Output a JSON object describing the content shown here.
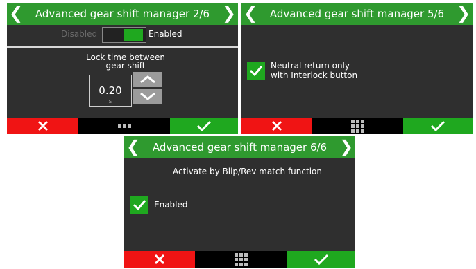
{
  "screens": [
    {
      "title": "Advanced gear shift manager 2/6",
      "toggle": {
        "off_label": "Disabled",
        "on_label": "Enabled",
        "state": "on"
      },
      "lock_time": {
        "label": "Lock time between gear shift",
        "value": "0.20",
        "unit": "s"
      }
    },
    {
      "title": "Advanced gear shift manager 5/6",
      "checkbox": {
        "label_line1": "Neutral return only",
        "label_line2": "with Interlock button",
        "checked": true
      }
    },
    {
      "title": "Advanced gear shift manager 6/6",
      "heading": "Activate by Blip/Rev match function",
      "checkbox": {
        "label": "Enabled",
        "checked": true
      }
    }
  ],
  "icons": {
    "prev": "chevron-left-icon",
    "next": "chevron-right-icon",
    "cancel": "x-icon",
    "confirm": "check-icon",
    "menu": "grid-menu-icon"
  },
  "colors": {
    "header": "#2f9a2f",
    "screen_bg": "#2f2f2f",
    "cancel": "#f01414",
    "confirm": "#1fa81f",
    "checkbox": "#1fa81f"
  }
}
